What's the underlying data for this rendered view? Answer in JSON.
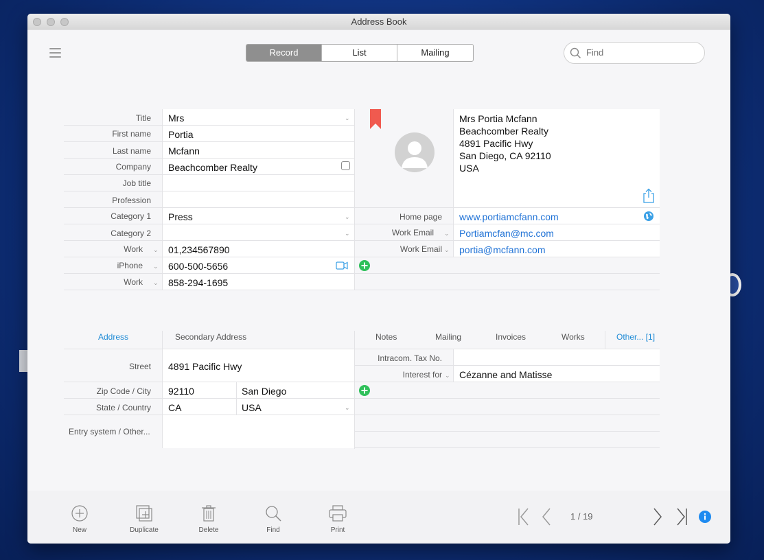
{
  "window": {
    "title": "Address Book"
  },
  "toolbar": {
    "tabs": [
      {
        "label": "Record"
      },
      {
        "label": "List"
      },
      {
        "label": "Mailing"
      }
    ],
    "search_placeholder": "Find"
  },
  "record": {
    "labels": {
      "title": "Title",
      "first_name": "First name",
      "last_name": "Last name",
      "company": "Company",
      "job_title": "Job title",
      "profession": "Profession",
      "category1": "Category 1",
      "category2": "Category 2",
      "phone1": "Work",
      "phone2": "iPhone",
      "phone3": "Work"
    },
    "values": {
      "title": "Mrs",
      "first_name": "Portia",
      "last_name": "Mcfann",
      "company": "Beachcomber Realty",
      "job_title": "",
      "profession": "",
      "category1": "Press",
      "category2": "",
      "phone1": "01,234567890",
      "phone2": "600-500-5656",
      "phone3": "858-294-1695"
    },
    "address_card": [
      "Mrs Portia Mcfann",
      "Beachcomber Realty",
      "4891 Pacific Hwy",
      "San Diego, CA 92110",
      "USA"
    ],
    "web": {
      "home_label": "Home page",
      "home_value": "www.portiamcfann.com",
      "email1_label": "Work Email",
      "email1_value": "Portiamcfan@mc.com",
      "email2_label": "Work Email",
      "email2_value": "portia@mcfann.com"
    }
  },
  "address_section": {
    "tabs": [
      {
        "label": "Address"
      },
      {
        "label": "Secondary Address"
      }
    ],
    "labels": {
      "street": "Street",
      "zip_city": "Zip Code / City",
      "state_country": "State / Country",
      "entry": "Entry system / Other..."
    },
    "values": {
      "street": "4891 Pacific Hwy",
      "zip": "92110",
      "city": "San Diego",
      "state": "CA",
      "country": "USA"
    }
  },
  "notes_section": {
    "tabs": [
      {
        "label": "Notes"
      },
      {
        "label": "Mailing"
      },
      {
        "label": "Invoices"
      },
      {
        "label": "Works"
      },
      {
        "label": "Other... [1]"
      }
    ],
    "labels": {
      "tax": "Intracom. Tax No.",
      "interest": "Interest for"
    },
    "values": {
      "tax": "",
      "interest": "Cézanne and Matisse"
    }
  },
  "bottom": {
    "buttons": [
      {
        "label": "New"
      },
      {
        "label": "Duplicate"
      },
      {
        "label": "Delete"
      },
      {
        "label": "Find"
      },
      {
        "label": "Print"
      }
    ],
    "pager": "1 / 19"
  },
  "colors": {
    "accent": "#1f72d6",
    "bookmark": "#f05a4f",
    "add": "#2fc05a",
    "info": "#1f8bf0"
  }
}
